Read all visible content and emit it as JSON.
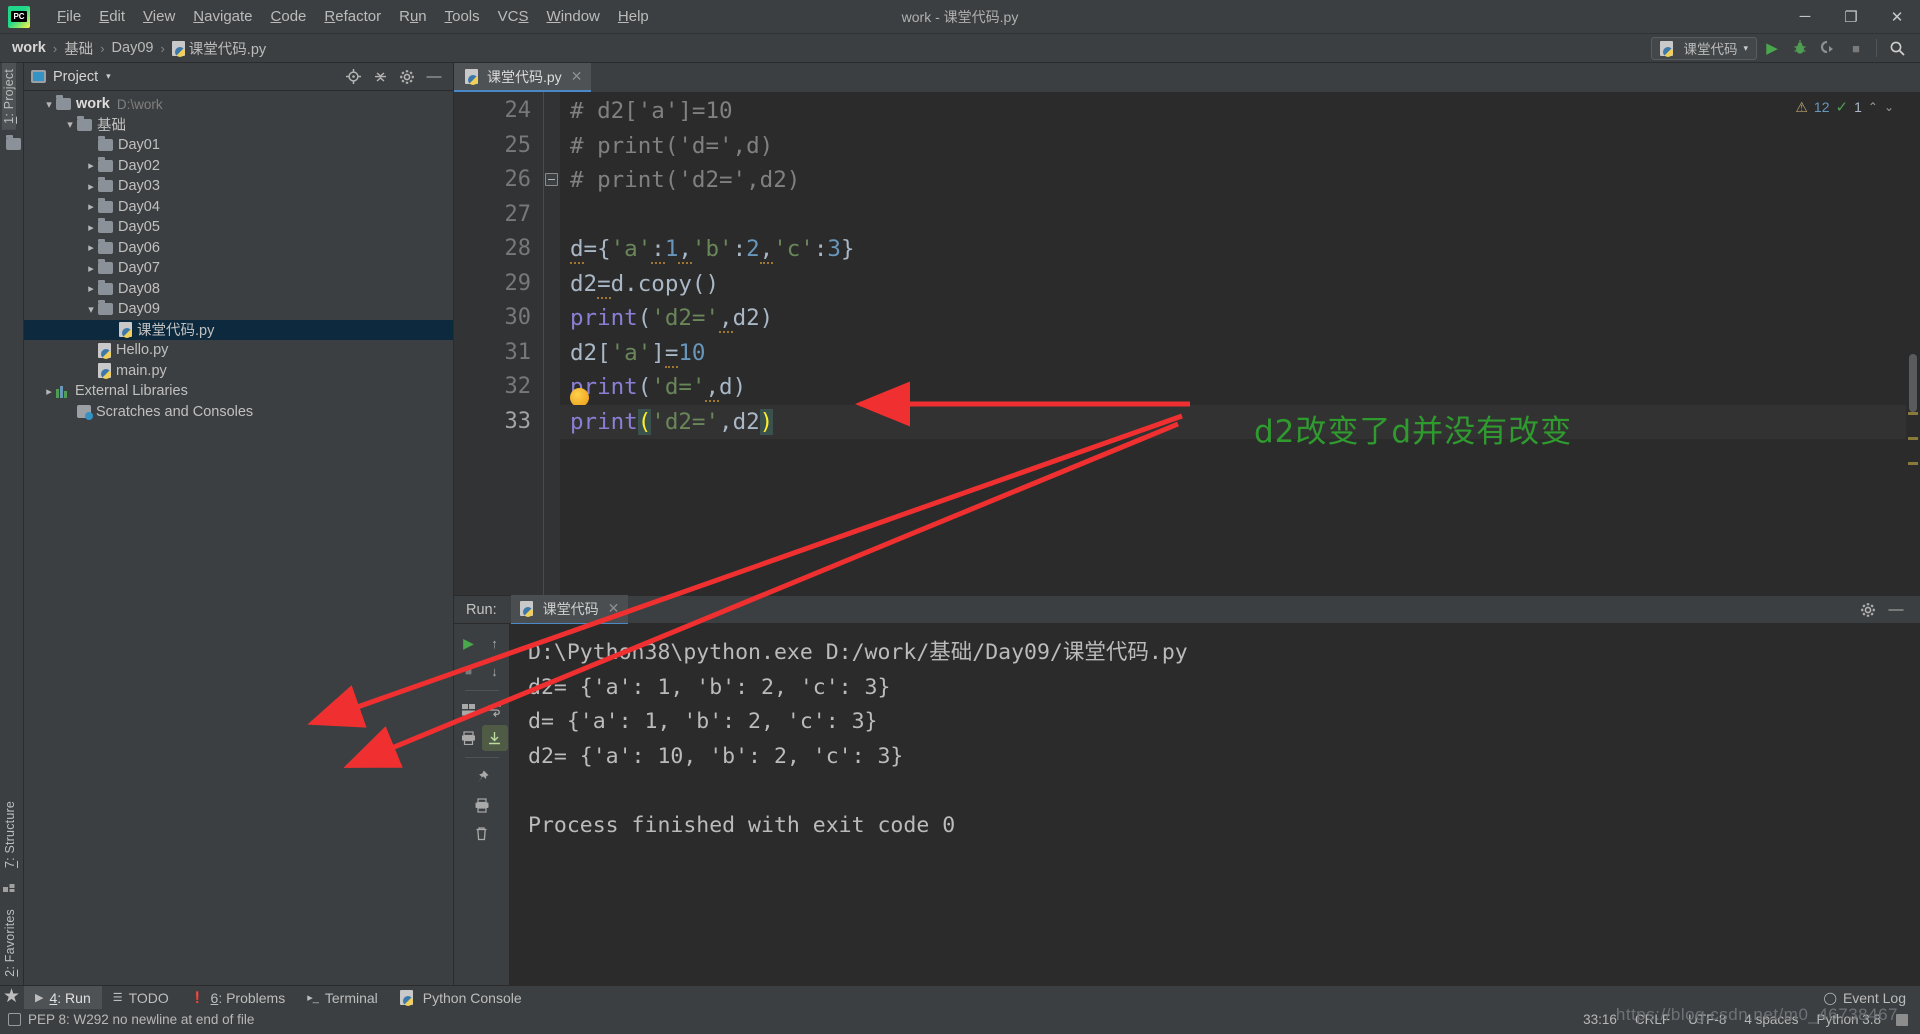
{
  "window": {
    "title": "work - 课堂代码.py",
    "logo_text": "PC",
    "minimize": "─",
    "maximize": "❐",
    "close": "✕"
  },
  "menubar": [
    {
      "label": "File",
      "mnemonic": "F"
    },
    {
      "label": "Edit",
      "mnemonic": "E"
    },
    {
      "label": "View",
      "mnemonic": "V"
    },
    {
      "label": "Navigate",
      "mnemonic": "N"
    },
    {
      "label": "Code",
      "mnemonic": "C"
    },
    {
      "label": "Refactor",
      "mnemonic": "R"
    },
    {
      "label": "Run",
      "mnemonic": "u"
    },
    {
      "label": "Tools",
      "mnemonic": "T"
    },
    {
      "label": "VCS",
      "mnemonic": "S"
    },
    {
      "label": "Window",
      "mnemonic": "W"
    },
    {
      "label": "Help",
      "mnemonic": "H"
    }
  ],
  "breadcrumb": {
    "items": [
      "work",
      "基础",
      "Day09",
      "课堂代码.py"
    ],
    "separator": "›"
  },
  "navbar_right": {
    "run_config": "课堂代码",
    "dropdown_caret": "▾",
    "run_icon": "▶",
    "debug_icon": "debug-bug-icon",
    "coverage_icon": "coverage-icon",
    "stop_icon": "■",
    "search_icon": "⌕"
  },
  "left_rail": [
    {
      "label": "1: Project",
      "mnemonic": "1",
      "active": true
    },
    {
      "label": "7: Structure",
      "mnemonic": "7",
      "active": false
    },
    {
      "label": "2: Favorites",
      "mnemonic": "2",
      "active": false
    }
  ],
  "project_panel": {
    "title": "Project",
    "caret": "▾",
    "buttons": [
      "locate-icon",
      "collapse-all-icon",
      "settings-gear-icon",
      "hide-icon"
    ],
    "tree": [
      {
        "depth": 0,
        "arrow": "down",
        "icon": "folder",
        "label": "work",
        "bold": true,
        "path": "D:\\work",
        "selected": false
      },
      {
        "depth": 1,
        "arrow": "down",
        "icon": "folder",
        "label": "基础",
        "bold": false,
        "path": "",
        "selected": false
      },
      {
        "depth": 2,
        "arrow": "none",
        "icon": "folder",
        "label": "Day01",
        "bold": false,
        "path": "",
        "selected": false
      },
      {
        "depth": 2,
        "arrow": "right",
        "icon": "folder",
        "label": "Day02",
        "bold": false,
        "path": "",
        "selected": false
      },
      {
        "depth": 2,
        "arrow": "right",
        "icon": "folder",
        "label": "Day03",
        "bold": false,
        "path": "",
        "selected": false
      },
      {
        "depth": 2,
        "arrow": "right",
        "icon": "folder",
        "label": "Day04",
        "bold": false,
        "path": "",
        "selected": false
      },
      {
        "depth": 2,
        "arrow": "right",
        "icon": "folder",
        "label": "Day05",
        "bold": false,
        "path": "",
        "selected": false
      },
      {
        "depth": 2,
        "arrow": "right",
        "icon": "folder",
        "label": "Day06",
        "bold": false,
        "path": "",
        "selected": false
      },
      {
        "depth": 2,
        "arrow": "right",
        "icon": "folder",
        "label": "Day07",
        "bold": false,
        "path": "",
        "selected": false
      },
      {
        "depth": 2,
        "arrow": "right",
        "icon": "folder",
        "label": "Day08",
        "bold": false,
        "path": "",
        "selected": false
      },
      {
        "depth": 2,
        "arrow": "down",
        "icon": "folder",
        "label": "Day09",
        "bold": false,
        "path": "",
        "selected": false
      },
      {
        "depth": 3,
        "arrow": "none",
        "icon": "python",
        "label": "课堂代码.py",
        "bold": false,
        "path": "",
        "selected": true
      },
      {
        "depth": 2,
        "arrow": "none",
        "icon": "python",
        "label": "Hello.py",
        "bold": false,
        "path": "",
        "selected": false
      },
      {
        "depth": 2,
        "arrow": "none",
        "icon": "python",
        "label": "main.py",
        "bold": false,
        "path": "",
        "selected": false
      },
      {
        "depth": 0,
        "arrow": "right",
        "icon": "library",
        "label": "External Libraries",
        "bold": false,
        "path": "",
        "selected": false
      },
      {
        "depth": 1,
        "arrow": "none",
        "icon": "scratch",
        "label": "Scratches and Consoles",
        "bold": false,
        "path": "",
        "selected": false
      }
    ]
  },
  "editor": {
    "tab": {
      "label": "课堂代码.py",
      "close": "✕"
    },
    "inspection": {
      "warning_icon": "⚠",
      "warning_count": "12",
      "ok_icon": "ok-check-icon",
      "ok_count": "1",
      "up": "⌃",
      "down": "⌄"
    },
    "lines": [
      {
        "num": "24",
        "fold": false,
        "caret": false,
        "tokens": [
          {
            "t": "# d2['a']=10",
            "c": "c-comment"
          }
        ]
      },
      {
        "num": "25",
        "fold": false,
        "caret": false,
        "tokens": [
          {
            "t": "# print('d=',d)",
            "c": "c-comment"
          }
        ]
      },
      {
        "num": "26",
        "fold": true,
        "caret": false,
        "tokens": [
          {
            "t": "# print('d2=',d2)",
            "c": "c-comment"
          }
        ]
      },
      {
        "num": "27",
        "fold": false,
        "caret": false,
        "tokens": []
      },
      {
        "num": "28",
        "fold": false,
        "caret": false,
        "tokens": [
          {
            "t": "d",
            "c": "c-ident squig"
          },
          {
            "t": "={",
            "c": "c-punc"
          },
          {
            "t": "'a'",
            "c": "c-string"
          },
          {
            "t": ":",
            "c": "c-punc squig"
          },
          {
            "t": "1",
            "c": "c-num"
          },
          {
            "t": ",",
            "c": "c-punc squig"
          },
          {
            "t": "'b'",
            "c": "c-string"
          },
          {
            "t": ":",
            "c": "c-punc"
          },
          {
            "t": "2",
            "c": "c-num"
          },
          {
            "t": ",",
            "c": "c-punc squig"
          },
          {
            "t": "'c'",
            "c": "c-string"
          },
          {
            "t": ":",
            "c": "c-punc"
          },
          {
            "t": "3",
            "c": "c-num"
          },
          {
            "t": "}",
            "c": "c-punc"
          }
        ]
      },
      {
        "num": "29",
        "fold": false,
        "caret": false,
        "tokens": [
          {
            "t": "d2",
            "c": "c-ident"
          },
          {
            "t": "=",
            "c": "c-punc squig"
          },
          {
            "t": "d.copy()",
            "c": "c-ident"
          }
        ]
      },
      {
        "num": "30",
        "fold": false,
        "caret": false,
        "tokens": [
          {
            "t": "print",
            "c": "c-func"
          },
          {
            "t": "(",
            "c": "c-punc"
          },
          {
            "t": "'d2='",
            "c": "c-string"
          },
          {
            "t": ",",
            "c": "c-punc squig"
          },
          {
            "t": "d2",
            "c": "c-ident"
          },
          {
            "t": ")",
            "c": "c-punc"
          }
        ]
      },
      {
        "num": "31",
        "fold": false,
        "caret": false,
        "tokens": [
          {
            "t": "d2",
            "c": "c-ident"
          },
          {
            "t": "[",
            "c": "c-punc"
          },
          {
            "t": "'a'",
            "c": "c-string"
          },
          {
            "t": "]",
            "c": "c-punc"
          },
          {
            "t": "=",
            "c": "c-punc squig"
          },
          {
            "t": "10",
            "c": "c-num"
          }
        ]
      },
      {
        "num": "32",
        "fold": false,
        "caret": false,
        "bulb": true,
        "tokens": [
          {
            "t": "print",
            "c": "c-func"
          },
          {
            "t": "(",
            "c": "c-punc"
          },
          {
            "t": "'d='",
            "c": "c-string"
          },
          {
            "t": ",",
            "c": "c-punc squig"
          },
          {
            "t": "d",
            "c": "c-ident"
          },
          {
            "t": ")",
            "c": "c-punc"
          }
        ]
      },
      {
        "num": "33",
        "fold": false,
        "caret": true,
        "tokens": [
          {
            "t": "print",
            "c": "c-func"
          },
          {
            "t": "(",
            "c": "c-brace-hl"
          },
          {
            "t": "'d2='",
            "c": "c-string"
          },
          {
            "t": ",",
            "c": "c-punc"
          },
          {
            "t": "d2",
            "c": "c-ident"
          },
          {
            "t": ")",
            "c": "c-brace-hl"
          }
        ]
      }
    ]
  },
  "annotation": {
    "text": "d2改变了d并没有改变",
    "color": "#2f9b2f",
    "arrow_color": "#f03030"
  },
  "run_panel": {
    "label": "Run:",
    "tab": {
      "label": "课堂代码",
      "close": "✕"
    },
    "header_buttons": [
      "settings-gear-icon",
      "hide-panel-icon"
    ],
    "tools": [
      "rerun-icon",
      "stop-icon",
      "up-arrow-icon",
      "down-arrow-icon",
      "print-icon",
      "soft-wrap-icon",
      "scroll-to-end-icon",
      "pin-icon",
      "printer-icon",
      "trash-icon"
    ],
    "console_lines": [
      "D:\\Python38\\python.exe D:/work/基础/Day09/课堂代码.py",
      "d2= {'a': 1, 'b': 2, 'c': 3}",
      "d= {'a': 1, 'b': 2, 'c': 3}",
      "d2= {'a': 10, 'b': 2, 'c': 3}",
      "",
      "Process finished with exit code 0"
    ]
  },
  "bottom_strip": {
    "tabs": [
      {
        "label": "4: Run",
        "mnemonic": "4",
        "icon": "▶",
        "active": true
      },
      {
        "label": "TODO",
        "mnemonic": "",
        "icon": "☰",
        "active": false
      },
      {
        "label": "6: Problems",
        "mnemonic": "6",
        "icon": "❗",
        "active": false
      },
      {
        "label": "Terminal",
        "mnemonic": "",
        "icon": "▸_",
        "active": false
      },
      {
        "label": "Python Console",
        "mnemonic": "",
        "icon": "python-icon",
        "active": false
      }
    ],
    "event_log": {
      "label": "Event Log",
      "icon": "◯"
    }
  },
  "status_bar": {
    "message": "PEP 8: W292 no newline at end of file",
    "caret_position": "33:16",
    "line_separator": "CRLF",
    "encoding": "UTF-8",
    "indent": "4 spaces",
    "interpreter": "Python 3.8",
    "lock_icon": "lock-icon",
    "watermark": "https://blog.csdn.net/m0_46738467"
  }
}
